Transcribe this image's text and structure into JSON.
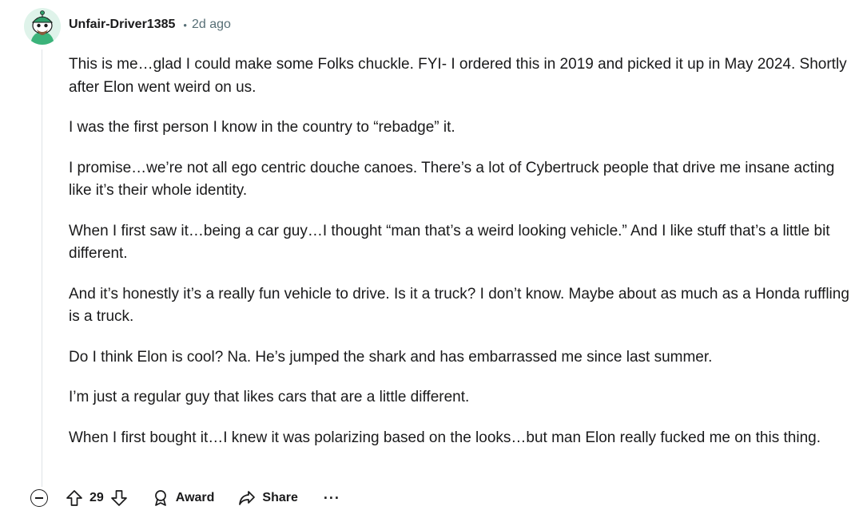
{
  "comment": {
    "username": "Unfair-Driver1385",
    "separator": "•",
    "timestamp": "2d ago",
    "avatar_icon": "snoo-avatar-icon",
    "paragraphs": [
      "This is me…glad I could make some Folks chuckle. FYI- I ordered this in 2019 and picked it up in May 2024. Shortly after Elon went weird on us.",
      "I was the first person I know in the country to “rebadge” it.",
      "I promise…we’re not all ego centric douche canoes. There’s a lot of Cybertruck people that drive me insane acting like it’s their whole identity.",
      "When I first saw it…being a car guy…I thought “man that’s a weird looking vehicle.” And I like stuff that’s a little bit different.",
      "And it’s honestly it’s a really fun vehicle to drive. Is it a truck? I don’t know. Maybe about as much as a Honda ruffling is a truck.",
      "Do I think Elon is cool? Na. He’s jumped the shark and has embarrassed me since last summer.",
      "I’m just a regular guy that likes cars that are a little different.",
      "When I first bought it…I knew it was polarizing based on the looks…but man Elon really fucked me on this thing."
    ]
  },
  "actions": {
    "vote_count": "29",
    "award_label": "Award",
    "share_label": "Share",
    "more_label": "···"
  },
  "colors": {
    "text": "#1a1a1b",
    "meta": "#576f76",
    "thread_line": "#dfe3e6",
    "avatar_bg": "#e6f7f1",
    "avatar_accent": "#3bb37a"
  }
}
